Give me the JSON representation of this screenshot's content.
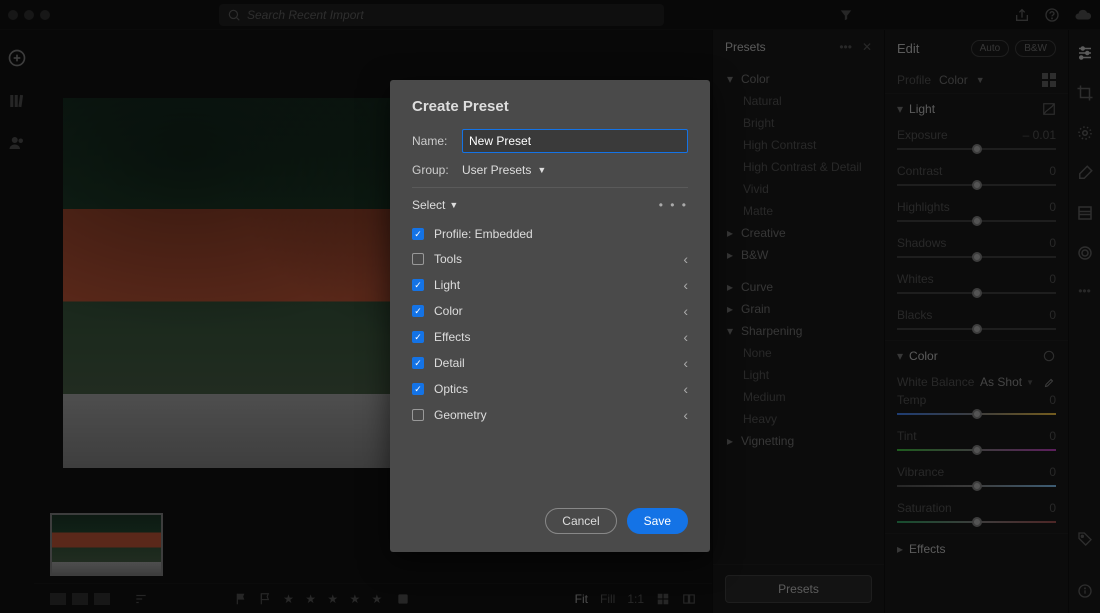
{
  "top": {
    "search_placeholder": "Search Recent Import"
  },
  "presets": {
    "title": "Presets",
    "groups": [
      {
        "label": "Color",
        "open": true,
        "items": [
          "Natural",
          "Bright",
          "High Contrast",
          "High Contrast & Detail",
          "Vivid",
          "Matte"
        ]
      },
      {
        "label": "Creative",
        "open": false,
        "items": []
      },
      {
        "label": "B&W",
        "open": false,
        "items": []
      }
    ],
    "curve": "Curve",
    "grain": "Grain",
    "sharpening": {
      "label": "Sharpening",
      "open": true,
      "items": [
        "None",
        "Light",
        "Medium",
        "Heavy"
      ]
    },
    "vignetting": "Vignetting"
  },
  "edit": {
    "title": "Edit",
    "auto": "Auto",
    "bw": "B&W",
    "profile_label": "Profile",
    "profile_value": "Color",
    "sections": {
      "light": {
        "title": "Light",
        "exposure": {
          "label": "Exposure",
          "value": "– 0.01"
        },
        "contrast": {
          "label": "Contrast",
          "value": "0"
        },
        "highlights": {
          "label": "Highlights",
          "value": "0"
        },
        "shadows": {
          "label": "Shadows",
          "value": "0"
        },
        "whites": {
          "label": "Whites",
          "value": "0"
        },
        "blacks": {
          "label": "Blacks",
          "value": "0"
        }
      },
      "color": {
        "title": "Color",
        "wb_label": "White Balance",
        "wb_value": "As Shot",
        "temp": {
          "label": "Temp",
          "value": "0"
        },
        "tint": {
          "label": "Tint",
          "value": "0"
        },
        "vibrance": {
          "label": "Vibrance",
          "value": "0"
        },
        "saturation": {
          "label": "Saturation",
          "value": "0"
        }
      },
      "effects": {
        "title": "Effects"
      }
    },
    "presets_button": "Presets"
  },
  "bottom": {
    "fit": "Fit",
    "fill": "Fill",
    "onetoone": "1:1"
  },
  "dialog": {
    "title": "Create Preset",
    "name_label": "Name:",
    "name_value": "New Preset",
    "group_label": "Group:",
    "group_value": "User Presets",
    "select_label": "Select",
    "rows": [
      {
        "label": "Profile: Embedded",
        "checked": true,
        "expandable": false
      },
      {
        "label": "Tools",
        "checked": false,
        "expandable": true
      },
      {
        "label": "Light",
        "checked": true,
        "expandable": true
      },
      {
        "label": "Color",
        "checked": true,
        "expandable": true
      },
      {
        "label": "Effects",
        "checked": true,
        "expandable": true
      },
      {
        "label": "Detail",
        "checked": true,
        "expandable": true
      },
      {
        "label": "Optics",
        "checked": true,
        "expandable": true
      },
      {
        "label": "Geometry",
        "checked": false,
        "expandable": true
      }
    ],
    "cancel": "Cancel",
    "save": "Save"
  }
}
